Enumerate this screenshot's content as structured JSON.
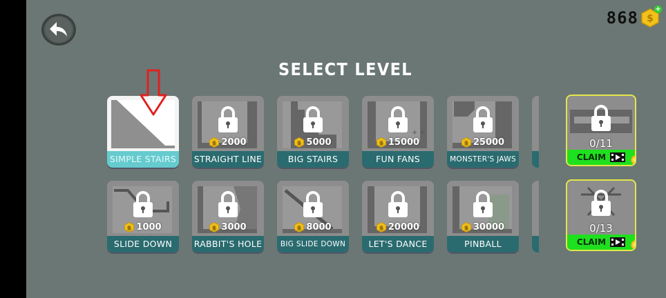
{
  "coins": "868",
  "title": "SELECT LEVEL",
  "levels": [
    {
      "name": "SIMPLE STAIRS",
      "price": null,
      "unlocked": true
    },
    {
      "name": "STRAIGHT LINE",
      "price": "2000"
    },
    {
      "name": "BIG STAIRS",
      "price": "5000"
    },
    {
      "name": "FUN FANS",
      "price": "15000"
    },
    {
      "name": "MONSTER'S JAWS",
      "price": "25000"
    },
    {
      "name": "SLIDE DOWN",
      "price": "1000"
    },
    {
      "name": "RABBIT'S HOLE",
      "price": "3000"
    },
    {
      "name": "BIG SLIDE DOWN",
      "price": "8000"
    },
    {
      "name": "LET'S DANCE",
      "price": "20000"
    },
    {
      "name": "PINBALL",
      "price": "30000"
    }
  ],
  "bonus": [
    {
      "progress": "0/11",
      "claim": "CLAIM"
    },
    {
      "progress": "0/13",
      "claim": "CLAIM"
    }
  ],
  "colors": {
    "background": "#6b7774",
    "label_teal": "#2a6b6f",
    "claim_green": "#1fe01f",
    "coin_gold": "#f2c21a",
    "arrow_red": "#e02020"
  },
  "icons": [
    "back-arrow-icon",
    "coin-icon",
    "plus-icon",
    "lock-icon",
    "film-icon",
    "red-arrow-icon"
  ]
}
